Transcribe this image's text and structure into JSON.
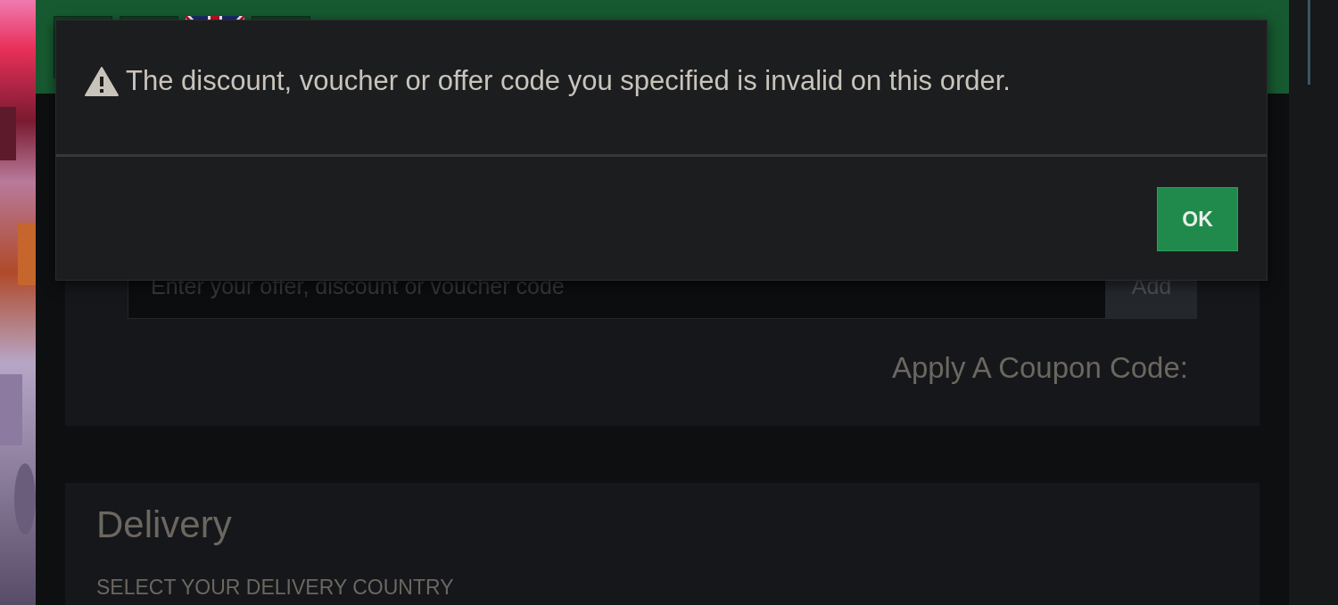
{
  "dialog": {
    "message": "The discount, voucher or offer code you specified is invalid on this order.",
    "button": "OK"
  },
  "coupon": {
    "placeholder": "Enter your offer, discount or voucher code",
    "button": "Add",
    "label": "Apply A Coupon Code:"
  },
  "delivery": {
    "title": "Delivery",
    "subtitle": "SELECT YOUR DELIVERY COUNTRY"
  }
}
